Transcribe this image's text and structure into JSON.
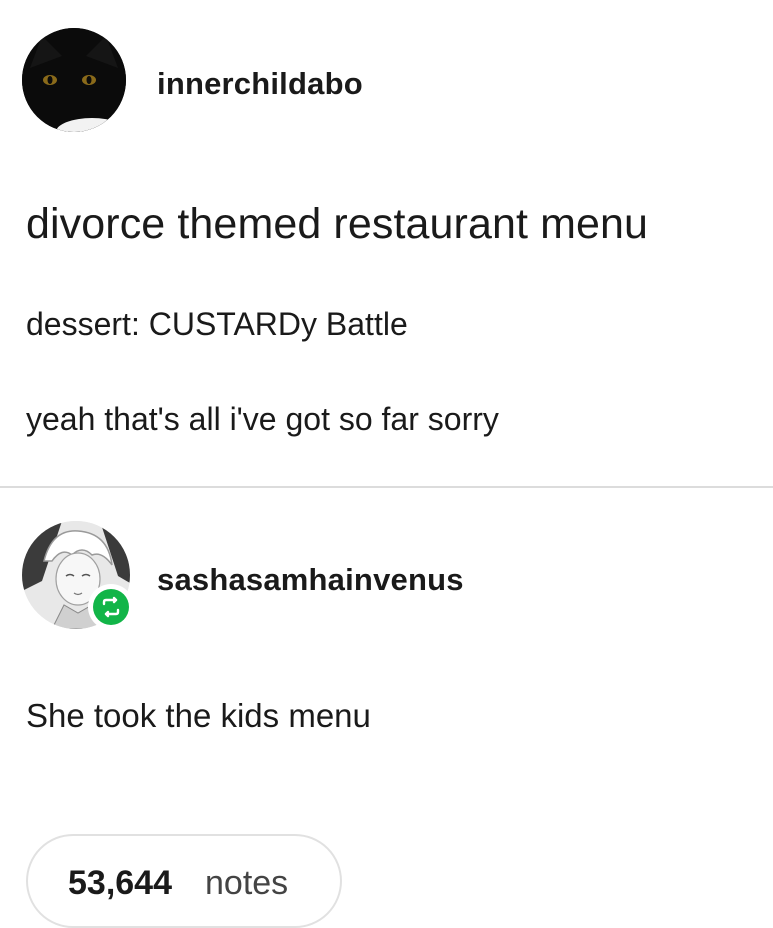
{
  "original_post": {
    "username": "innerchildabo",
    "title": "divorce themed restaurant menu",
    "lines": [
      "dessert: CUSTARDy Battle",
      "yeah that's all i've got so far sorry"
    ],
    "avatar_icon": "black-cat-avatar-icon"
  },
  "reblog": {
    "username": "sashasamhainvenus",
    "text": "She took the kids menu",
    "avatar_icon": "anime-character-avatar-icon",
    "badge_icon": "reblog-icon"
  },
  "footer": {
    "notes_count": "53,644",
    "notes_label": "notes"
  },
  "colors": {
    "reblog_green": "#12b548",
    "divider": "#dcdcdc",
    "text": "#1a1a1a"
  }
}
